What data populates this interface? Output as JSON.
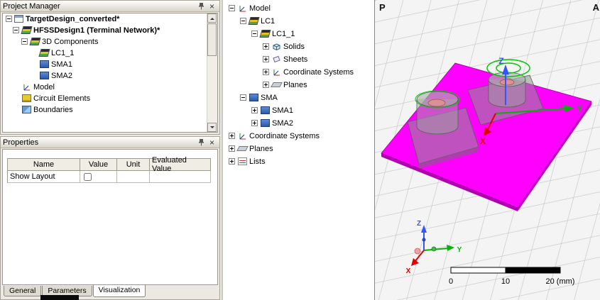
{
  "icons": {
    "close": "×"
  },
  "project_manager": {
    "title": "Project Manager",
    "tree": [
      {
        "label": "TargetDesign_converted*"
      },
      {
        "label": "HFSSDesign1 (Terminal Network)*"
      },
      {
        "label": "3D Components"
      },
      {
        "label": "LC1_1"
      },
      {
        "label": "SMA1"
      },
      {
        "label": "SMA2"
      },
      {
        "label": "Model"
      },
      {
        "label": "Circuit Elements"
      },
      {
        "label": "Boundaries"
      }
    ]
  },
  "properties_panel": {
    "title": "Properties",
    "columns": [
      "Name",
      "Value",
      "Unit",
      "Evaluated Value"
    ],
    "rows": [
      {
        "name": "Show Layout",
        "value_checked": false,
        "unit": "",
        "evaluated_value": ""
      }
    ],
    "tabs": [
      "General",
      "Parameters",
      "Visualization"
    ],
    "active_tab": "Visualization"
  },
  "model_tree": {
    "items": [
      {
        "label": "Model"
      },
      {
        "label": "LC1"
      },
      {
        "label": "LC1_1"
      },
      {
        "label": "Solids"
      },
      {
        "label": "Sheets"
      },
      {
        "label": "Coordinate Systems"
      },
      {
        "label": "Planes"
      },
      {
        "label": "SMA"
      },
      {
        "label": "SMA1"
      },
      {
        "label": "SMA2"
      },
      {
        "label": "Coordinate Systems"
      },
      {
        "label": "Planes"
      },
      {
        "label": "Lists"
      }
    ]
  },
  "viewport": {
    "corner_label_left": "P",
    "corner_label_right": "A",
    "axes": {
      "x": "X",
      "y": "Y",
      "z": "Z"
    },
    "triad": {
      "x": "X",
      "y": "Y",
      "z": "Z"
    },
    "scale": {
      "tick0": "0",
      "tick1": "10",
      "tick2": "20 (mm)"
    },
    "colors": {
      "board": "#FF00FF",
      "axis_x": "#E00000",
      "axis_y": "#00B400",
      "axis_z": "#3355FF"
    }
  }
}
